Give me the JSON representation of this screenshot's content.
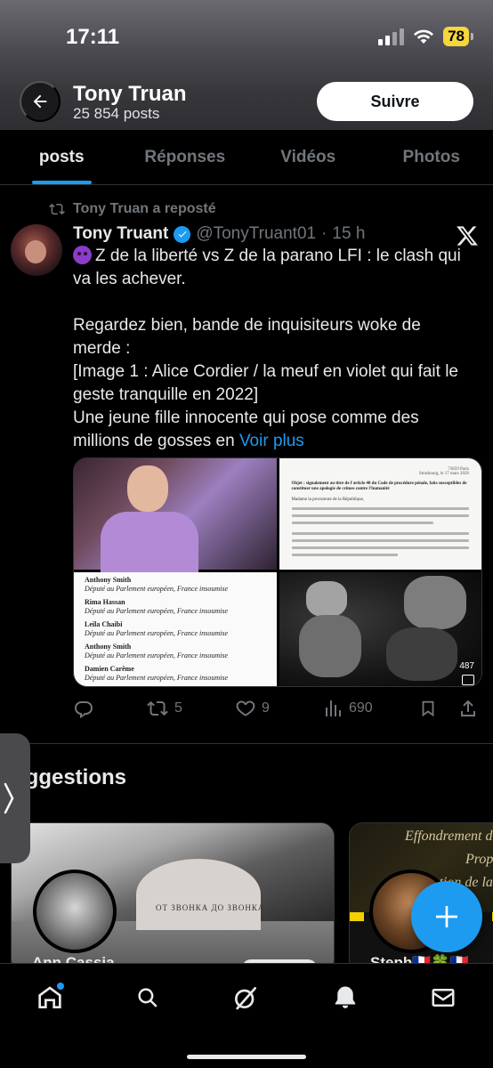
{
  "status_bar": {
    "time": "17:11",
    "battery": "78"
  },
  "header": {
    "name": "Tony Truan",
    "posts_count": "25 854 posts",
    "follow_label": "Suivre"
  },
  "tabs": [
    {
      "label": "posts",
      "active": true
    },
    {
      "label": "Réponses",
      "active": false
    },
    {
      "label": "Vidéos",
      "active": false
    },
    {
      "label": "Photos",
      "active": false
    }
  ],
  "post": {
    "repost_label": "Tony Truan a reposté",
    "author_name": "Tony Truant",
    "handle": "@TonyTruant01",
    "separator": "·",
    "time": "15 h",
    "text_main": "Z de la liberté vs Z de la parano LFI : le clash qui va les achever.\n\nRegardez bien, bande de inquisiteurs woke de merde :\n[Image 1 : Alice Cordier / la meuf en violet qui fait le geste tranquille en 2022]\nUne jeune fille innocente qui pose comme des millions de gosses en ",
    "see_more": "Voir plus",
    "media": {
      "doc_ref": "73859 Paris",
      "doc_date": "Strasbourg, le 17 mars 2026",
      "doc_subject": "Objet : signalement au titre de l'article 40 du Code de procédure pénale, faits susceptibles de constituer une apologie de crimes contre l'humanité",
      "doc_salutation": "Madame la procureure de la République,",
      "signatories": [
        {
          "name": "Anthony Smith",
          "role": "Député au Parlement européen,",
          "party": "France insoumise"
        },
        {
          "name": "Rima Hassan",
          "role": "Député au Parlement européen,",
          "party": "France insoumise"
        },
        {
          "name": "Leila Chaibi",
          "role": "Député au Parlement européen,",
          "party": "France insoumise"
        },
        {
          "name": "Anthony Smith",
          "role": "Député au Parlement européen,",
          "party": "France insoumise"
        },
        {
          "name": "Damien Carême",
          "role": "Député au Parlement européen,",
          "party": "France insoumise"
        }
      ],
      "video_views": "487"
    },
    "actions": {
      "reposts": "5",
      "likes": "9",
      "views": "690"
    }
  },
  "suggestions": {
    "title": "uggestions",
    "card1_tattoo": "ОТ ЗВОНКА ДО ЗВОНКА",
    "card1_name_peek": "Ann Cassia",
    "card2_banner_line1": "Effondrement du",
    "card2_banner_line2": "Propa",
    "card2_banner_line3": "ntation de la",
    "card2_name_peek": "Steph🇫🇷🍀🇫🇷"
  },
  "colors": {
    "accent": "#1d9bf0",
    "background": "#000000",
    "muted_text": "#71767b",
    "battery": "#f5d63d"
  },
  "icons": {
    "back": "arrow-left-icon",
    "repost": "repost-icon",
    "verified": "verified-badge-icon",
    "x_logo": "x-logo-icon",
    "reply": "reply-icon",
    "like": "heart-icon",
    "views": "bar-chart-icon",
    "bookmark": "bookmark-icon",
    "share": "share-icon",
    "compose": "plus-icon",
    "home": "home-icon",
    "search": "search-icon",
    "grok": "grok-icon",
    "notifications": "bell-icon",
    "messages": "mail-icon"
  }
}
